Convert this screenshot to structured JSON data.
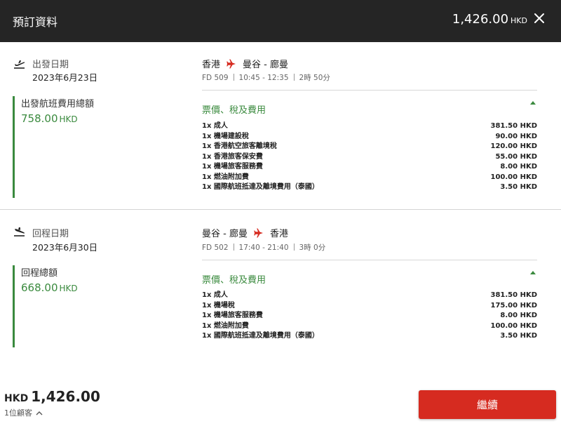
{
  "header": {
    "title": "預訂資料",
    "total_amount": "1,426.00",
    "total_currency": "HKD"
  },
  "outbound": {
    "date_label": "出發日期",
    "date": "2023年6月23日",
    "fare_label": "出發航班費用總額",
    "fare_amount": "758.00",
    "fare_currency": "HKD",
    "origin": "香港",
    "destination": "曼谷 - 廊曼",
    "flight_no": "FD 509",
    "time": "10:45 - 12:35",
    "duration": "2時 50分",
    "fees_title": "票價、稅及費用",
    "fees": [
      {
        "label": "1x 成人",
        "amount": "381.50 HKD"
      },
      {
        "label": "1x 機場建設稅",
        "amount": "90.00 HKD"
      },
      {
        "label": "1x 香港航空旅客離境稅",
        "amount": "120.00 HKD"
      },
      {
        "label": "1x 香港旅客保安費",
        "amount": "55.00 HKD"
      },
      {
        "label": "1x 機場旅客服務費",
        "amount": "8.00 HKD"
      },
      {
        "label": "1x 燃油附加費",
        "amount": "100.00 HKD"
      },
      {
        "label": "1x 國際航班抵達及離境費用（泰國）",
        "amount": "3.50 HKD"
      }
    ]
  },
  "return": {
    "date_label": "回程日期",
    "date": "2023年6月30日",
    "fare_label": "回程總額",
    "fare_amount": "668.00",
    "fare_currency": "HKD",
    "origin": "曼谷 - 廊曼",
    "destination": "香港",
    "flight_no": "FD 502",
    "time": "17:40 - 21:40",
    "duration": "3時 0分",
    "fees_title": "票價、稅及費用",
    "fees": [
      {
        "label": "1x 成人",
        "amount": "381.50 HKD"
      },
      {
        "label": "1x 機場稅",
        "amount": "175.00 HKD"
      },
      {
        "label": "1x 機場旅客服務費",
        "amount": "8.00 HKD"
      },
      {
        "label": "1x 燃油附加費",
        "amount": "100.00 HKD"
      },
      {
        "label": "1x 國際航班抵達及離境費用（泰國）",
        "amount": "3.50 HKD"
      }
    ]
  },
  "footer": {
    "currency": "HKD",
    "total": "1,426.00",
    "passengers": "1位顧客",
    "continue_label": "繼續"
  },
  "colors": {
    "header_bg": "#252525",
    "accent_green": "#3a8a3e",
    "primary_red": "#d62b20",
    "plane_red": "#d62b20"
  },
  "icons": {
    "close": "close-icon",
    "departure": "plane-takeoff-icon",
    "arrival": "plane-landing-icon",
    "route": "plane-icon",
    "expand": "chevron-up-icon"
  }
}
